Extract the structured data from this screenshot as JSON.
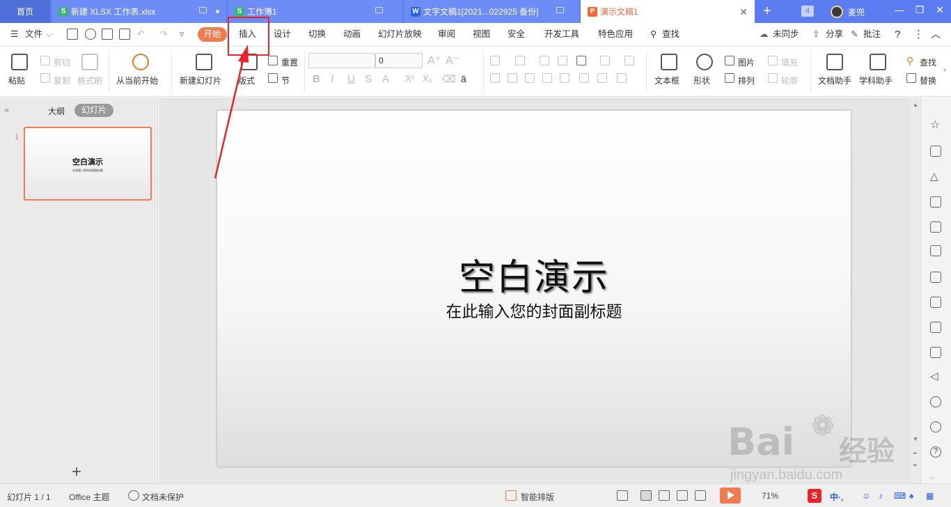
{
  "tabs": {
    "home": "首页",
    "xlsx": "新建 XLSX 工作表.xlsx",
    "gongzuobu": "工作簿1",
    "doc": "文字文稿1[2021...022925 备份]",
    "ppt": "演示文稿1",
    "count": "4",
    "username": "麦兜",
    "icon_s": "S",
    "icon_w": "W",
    "icon_p": "P"
  },
  "menu": {
    "file": "文件",
    "start": "开始",
    "insert": "插入",
    "design": "设计",
    "transition": "切换",
    "animation": "动画",
    "slideshow": "幻灯片放映",
    "review": "审阅",
    "view": "视图",
    "security": "安全",
    "devtools": "开发工具",
    "special": "特色应用",
    "search": "查找",
    "unsynced": "未同步",
    "share": "分享",
    "comment": "批注"
  },
  "ribbon": {
    "paste": "粘贴",
    "cut": "剪切",
    "copy": "复制",
    "format_painter": "格式刷",
    "from_current": "从当前开始",
    "new_slide": "新建幻灯片",
    "layout": "版式",
    "reset": "重置",
    "section": "节",
    "font_size": "0",
    "textbox": "文本框",
    "shape": "形状",
    "picture": "图片",
    "arrange": "排列",
    "fill": "填充",
    "outline": "轮廓",
    "doc_helper": "文档助手",
    "subject_helper": "学科助手",
    "find": "查找",
    "replace": "替换"
  },
  "sidebar": {
    "outline_tab": "大纲",
    "slides_tab": "幻灯片",
    "slide_number": "1",
    "thumb_title": "空白演示",
    "thumb_sub": "在此输入您的封面副标题",
    "add": "+"
  },
  "slide": {
    "title": "空白演示",
    "subtitle": "在此输入您的封面副标题"
  },
  "status": {
    "slide_count": "幻灯片 1 / 1",
    "theme": "Office 主题",
    "protection": "文档未保护",
    "smart_layout": "智能排版",
    "zoom": "71%"
  },
  "watermark": {
    "brand": "Bai",
    "brand2": "经验",
    "url": "jingyan.baidu.com"
  },
  "colors": {
    "tabbar": "#5b7df1",
    "accent": "#f07b4f",
    "highlight": "#e8232a"
  }
}
